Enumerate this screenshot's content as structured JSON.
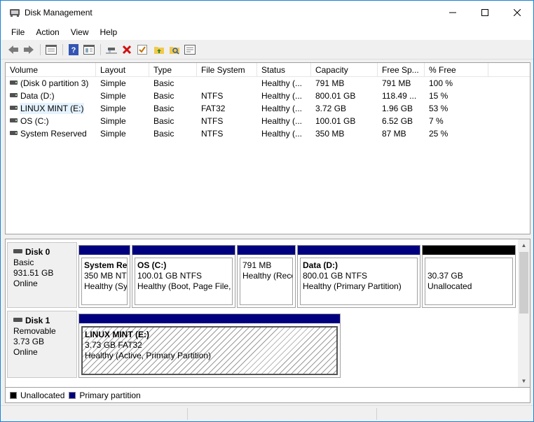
{
  "window": {
    "title": "Disk Management",
    "controls": {
      "minimize": "minimize-icon",
      "maximize": "maximize-icon",
      "close": "close-icon"
    }
  },
  "menu": [
    "File",
    "Action",
    "View",
    "Help"
  ],
  "toolbar": {
    "buttons": [
      "back-arrow-icon",
      "forward-arrow-icon",
      "list-view-icon",
      "help-icon",
      "properties-icon",
      "connect-icon",
      "delete-icon",
      "check-icon",
      "folder-up-icon",
      "search-folder-icon",
      "console-icon"
    ]
  },
  "volume_list": {
    "columns": [
      "Volume",
      "Layout",
      "Type",
      "File System",
      "Status",
      "Capacity",
      "Free Sp...",
      "% Free"
    ],
    "rows": [
      {
        "volume": "(Disk 0 partition 3)",
        "layout": "Simple",
        "type": "Basic",
        "fs": "",
        "status": "Healthy (...",
        "capacity": "791 MB",
        "free": "791 MB",
        "pct": "100 %"
      },
      {
        "volume": "Data (D:)",
        "layout": "Simple",
        "type": "Basic",
        "fs": "NTFS",
        "status": "Healthy (...",
        "capacity": "800.01 GB",
        "free": "118.49 ...",
        "pct": "15 %"
      },
      {
        "volume": "LINUX MINT (E:)",
        "layout": "Simple",
        "type": "Basic",
        "fs": "FAT32",
        "status": "Healthy (...",
        "capacity": "3.72 GB",
        "free": "1.96 GB",
        "pct": "53 %"
      },
      {
        "volume": "OS (C:)",
        "layout": "Simple",
        "type": "Basic",
        "fs": "NTFS",
        "status": "Healthy (...",
        "capacity": "100.01 GB",
        "free": "6.52 GB",
        "pct": "7 %"
      },
      {
        "volume": "System Reserved",
        "layout": "Simple",
        "type": "Basic",
        "fs": "NTFS",
        "status": "Healthy (...",
        "capacity": "350 MB",
        "free": "87 MB",
        "pct": "25 %"
      }
    ]
  },
  "disks": [
    {
      "name": "Disk 0",
      "kind": "Basic",
      "size": "931.51 GB",
      "state": "Online",
      "partitions": [
        {
          "name": "System Re",
          "line1": "350 MB NTI",
          "line2": "Healthy (Sy"
        },
        {
          "name": "OS  (C:)",
          "line1": "100.01 GB NTFS",
          "line2": "Healthy (Boot, Page File, ("
        },
        {
          "name": "",
          "line1": "791 MB",
          "line2": "Healthy (Reco"
        },
        {
          "name": "Data  (D:)",
          "line1": "800.01 GB NTFS",
          "line2": "Healthy (Primary Partition)"
        },
        {
          "name": "",
          "line1": "30.37 GB",
          "line2": "Unallocated"
        }
      ]
    },
    {
      "name": "Disk 1",
      "kind": "Removable",
      "size": "3.73 GB",
      "state": "Online",
      "partitions": [
        {
          "name": "LINUX MINT  (E:)",
          "line1": "3.73 GB FAT32",
          "line2": "Healthy (Active, Primary Partition)"
        }
      ]
    }
  ],
  "legend": {
    "unallocated": {
      "label": "Unallocated",
      "color": "#000000"
    },
    "primary": {
      "label": "Primary partition",
      "color": "#00007f"
    }
  }
}
